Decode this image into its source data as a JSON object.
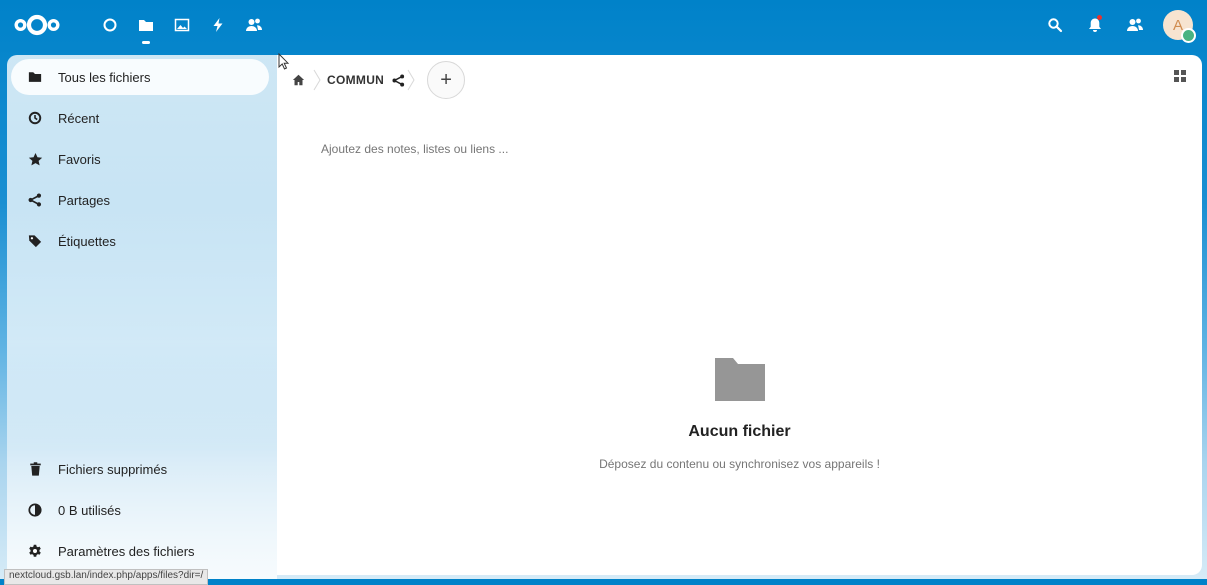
{
  "header": {
    "apps": [
      {
        "name": "dashboard",
        "icon": "circle-icon"
      },
      {
        "name": "files",
        "icon": "folder-icon",
        "active": true
      },
      {
        "name": "photos",
        "icon": "image-icon"
      },
      {
        "name": "activity",
        "icon": "lightning-icon"
      },
      {
        "name": "contacts",
        "icon": "users-icon"
      }
    ],
    "avatar_initial": "A"
  },
  "sidebar": {
    "items": [
      {
        "label": "Tous les fichiers",
        "icon": "folder-icon",
        "active": true
      },
      {
        "label": "Récent",
        "icon": "clock-icon"
      },
      {
        "label": "Favoris",
        "icon": "star-icon"
      },
      {
        "label": "Partages",
        "icon": "share-icon"
      },
      {
        "label": "Étiquettes",
        "icon": "tag-icon"
      }
    ],
    "footer": [
      {
        "label": "Fichiers supprimés",
        "icon": "trash-icon"
      },
      {
        "label": "0 B utilisés",
        "icon": "pie-icon"
      },
      {
        "label": "Paramètres des fichiers",
        "icon": "gear-icon"
      }
    ]
  },
  "main": {
    "breadcrumb": {
      "folder": "COMMUN"
    },
    "add_button": "+",
    "notes_placeholder": "Ajoutez des notes, listes ou liens ...",
    "empty_title": "Aucun fichier",
    "empty_description": "Déposez du contenu ou synchronisez vos appareils !"
  },
  "status_bar": {
    "url": "nextcloud.gsb.lan/index.php/apps/files?dir=/"
  },
  "colors": {
    "header": "#0082c9",
    "folder_gray": "#969696",
    "online": "#49b382"
  }
}
